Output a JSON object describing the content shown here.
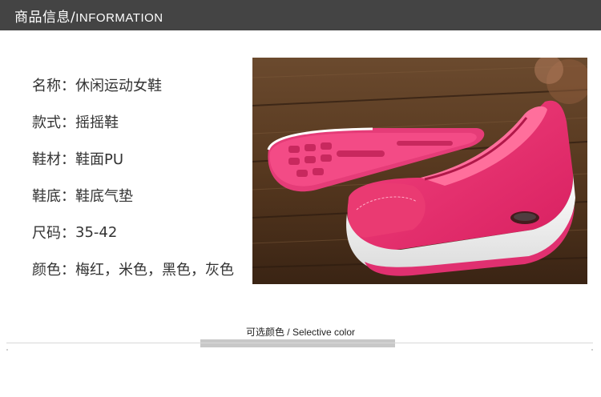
{
  "header": {
    "title_cn": "商品信息",
    "title_sep": "/",
    "title_en": "INFORMATION"
  },
  "specs": [
    {
      "label": "名称",
      "sep": "：",
      "value": "休闲运动女鞋"
    },
    {
      "label": "款式",
      "sep": "：",
      "value": "摇摇鞋"
    },
    {
      "label": "鞋材",
      "sep": "：",
      "value": "鞋面PU"
    },
    {
      "label": "鞋底",
      "sep": "：",
      "value": "鞋底气垫"
    },
    {
      "label": "尺码",
      "sep": "：",
      "value": "35-42"
    },
    {
      "label": "颜色",
      "sep": "：",
      "value": "梅红，米色，黑色，灰色"
    }
  ],
  "product_image": {
    "icon": "pink-rocker-shoe-photo",
    "colors": {
      "shoe": "#e8306e",
      "sole": "#f4f4f4",
      "wood": "#5a3a22"
    }
  },
  "selective_color": {
    "label": "可选颜色 / Selective color"
  },
  "colors": {
    "header_bg": "#444444",
    "header_text": "#ffffff",
    "body_text": "#333333"
  }
}
